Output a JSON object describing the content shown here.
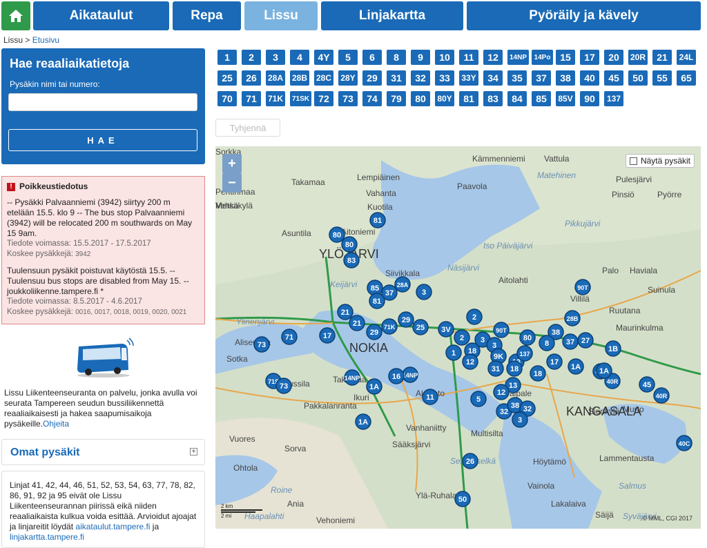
{
  "nav": {
    "home_icon": "home-icon",
    "items": [
      "Aikataulut",
      "Repa",
      "Lissu",
      "Linjakartta",
      "Pyöräily ja kävely"
    ]
  },
  "breadcrumb": {
    "root": "Lissu",
    "separator": " > ",
    "current": "Etusivu"
  },
  "search": {
    "title": "Hae reaaliaikatietoja",
    "label": "Pysäkin nimi tai numero:",
    "value": "",
    "button": "HAE"
  },
  "alert": {
    "title": "Poikkeustiedotus",
    "notices": [
      {
        "text": "-- Pysäkki Palvaanniemi (3942) siirtyy 200 m etelään 15.5. klo 9 -- The bus stop Palvaanniemi (3942) will be relocated 200 m southwards on May 15 9am.",
        "valid": "Tiedote voimassa: 15.5.2017 - 17.5.2017",
        "stops_label": "Koskee pysäkkejä:",
        "stops": "3942"
      },
      {
        "text": "Tuulensuun pysäkit poistuvat käytöstä 15.5. -- Tuulensuu bus stops are disabled from May 15. -- joukkoliikenne.tampere.fi *",
        "valid": "Tiedote voimassa: 8.5.2017 - 4.6.2017",
        "stops_label": "Koskee pysäkkejä:",
        "stops": "0016, 0017, 0018, 0019, 0020, 0021"
      }
    ]
  },
  "info": {
    "text": "Lissu Liikenteenseuranta on palvelu, jonka avulla voi seurata Tampereen seudun bussiliikennettä reaaliaikaisesti ja hakea saapumisaikoja pysäkeille.",
    "link": "Ohjeita"
  },
  "omat": {
    "title": "Omat pysäkit",
    "toggle": "⊞"
  },
  "lines_note": {
    "text": "Linjat 41, 42, 44, 46, 51, 52, 53, 54, 63, 77, 78, 82, 86, 91, 92 ja 95 eivät ole Lissu Liikenteenseurannan piirissä eikä niiden reaaliaikaista kulkua voida esittää. Arvioidut ajoajat ja linjareitit löydät",
    "link1": "aikataulut.tampere.fi",
    "mid": "ja",
    "link2": "linjakartta.tampere.fi"
  },
  "routes": [
    [
      "1",
      "2",
      "3",
      "4",
      "4Y",
      "5",
      "6",
      "8",
      "9",
      "10",
      "11",
      "12",
      "14NP",
      "14Po",
      "15",
      "17",
      "20",
      "20R",
      "21",
      "24L"
    ],
    [
      "25",
      "26",
      "28A",
      "28B",
      "28C",
      "28Y",
      "29",
      "31",
      "32",
      "33",
      "33Y",
      "34",
      "35",
      "37",
      "38",
      "40",
      "45",
      "50",
      "55",
      "65"
    ],
    [
      "70",
      "71",
      "71K",
      "71SK",
      "72",
      "73",
      "74",
      "79",
      "80",
      "80Y",
      "81",
      "83",
      "84",
      "85",
      "85V",
      "90",
      "137"
    ]
  ],
  "clear_button": "Tyhjennä",
  "map": {
    "zoom_in": "+",
    "zoom_out": "−",
    "show_stops": "Näytä pysäkit",
    "scale_km": "2 km",
    "scale_mi": "2 mi",
    "copyright": "© MML, CGI 2017",
    "labels": [
      {
        "t": "Kämmenniemi",
        "c": "#444"
      },
      {
        "t": "Vattula",
        "c": "#444"
      },
      {
        "t": "Takamaa",
        "c": "#444"
      },
      {
        "t": "Lempiäinen",
        "c": "#444"
      },
      {
        "t": "Vahanta",
        "c": "#444"
      },
      {
        "t": "Paavola",
        "c": "#444"
      },
      {
        "t": "Matehinen",
        "c": "#6a8fb4"
      },
      {
        "t": "Pulesjärvi",
        "c": "#444"
      },
      {
        "t": "Pentinmaa",
        "c": "#444"
      },
      {
        "t": "Pinsiö",
        "c": "#444"
      },
      {
        "t": "Pyörre",
        "c": "#444"
      },
      {
        "t": "Kuotila",
        "c": "#444"
      },
      {
        "t": "Vehka",
        "c": "#444"
      },
      {
        "t": "Metsäkylä",
        "c": "#444"
      },
      {
        "t": "Asuntila",
        "c": "#444"
      },
      {
        "t": "Aitoniemi",
        "c": "#444"
      },
      {
        "t": "Iso Päiväjärvi",
        "c": "#6a8fb4"
      },
      {
        "t": "Pikkujärvi",
        "c": "#6a8fb4"
      },
      {
        "t": "YLÖJÄRVI",
        "c": "#333"
      },
      {
        "t": "Siivikkala",
        "c": "#444"
      },
      {
        "t": "Näsijärvi",
        "c": "#6a8fb4"
      },
      {
        "t": "Aitolahti",
        "c": "#444"
      },
      {
        "t": "Palo",
        "c": "#444"
      },
      {
        "t": "Haviala",
        "c": "#444"
      },
      {
        "t": "Suinula",
        "c": "#444"
      },
      {
        "t": "Keijärvi",
        "c": "#6a8fb4"
      },
      {
        "t": "Ruutana",
        "c": "#444"
      },
      {
        "t": "Ylinenjärvi",
        "c": "#6a8fb4"
      },
      {
        "t": "Aliseutula",
        "c": "#444"
      },
      {
        "t": "NOKIA",
        "c": "#333"
      },
      {
        "t": "Villilä",
        "c": "#444"
      },
      {
        "t": "Maurinkulma",
        "c": "#444"
      },
      {
        "t": "Jussila",
        "c": "#444"
      },
      {
        "t": "Takamaa",
        "c": "#444"
      },
      {
        "t": "Taipale",
        "c": "#444"
      },
      {
        "t": "Sotka",
        "c": "#444"
      },
      {
        "t": "Alavisto",
        "c": "#444"
      },
      {
        "t": "Pakkalanranta",
        "c": "#444"
      },
      {
        "t": "Sionkylä",
        "c": "#444"
      },
      {
        "t": "Murto",
        "c": "#444"
      },
      {
        "t": "KANGASALA",
        "c": "#333"
      },
      {
        "t": "Vanhaniitty",
        "c": "#444"
      },
      {
        "t": "Multisilta",
        "c": "#444"
      },
      {
        "t": "Vuores",
        "c": "#444"
      },
      {
        "t": "Sorva",
        "c": "#444"
      },
      {
        "t": "Sääksjärvi",
        "c": "#444"
      },
      {
        "t": "Lammentausta",
        "c": "#444"
      },
      {
        "t": "Ohtola",
        "c": "#444"
      },
      {
        "t": "Servanselkä",
        "c": "#6a8fb4"
      },
      {
        "t": "Höytämö",
        "c": "#444"
      },
      {
        "t": "Ylä-Ruhala",
        "c": "#444"
      },
      {
        "t": "Vainola",
        "c": "#444"
      },
      {
        "t": "Salmus",
        "c": "#6a8fb4"
      },
      {
        "t": "Roine",
        "c": "#6a8fb4"
      },
      {
        "t": "Lakalaiva",
        "c": "#444"
      },
      {
        "t": "Ania",
        "c": "#444"
      },
      {
        "t": "Syväjärvi",
        "c": "#6a8fb4"
      },
      {
        "t": "Vehoniemi",
        "c": "#444"
      },
      {
        "t": "Säijä",
        "c": "#444"
      },
      {
        "t": "Haapalahti",
        "c": "#6a8fb4"
      },
      {
        "t": "Ikuri",
        "c": "#444"
      },
      {
        "t": "Sorkka",
        "c": "#444"
      }
    ],
    "buses": [
      "81",
      "80",
      "80",
      "83",
      "85",
      "28A",
      "37",
      "3",
      "81",
      "90T",
      "21",
      "21",
      "17",
      "71",
      "73",
      "29",
      "71K",
      "29",
      "25",
      "3V",
      "2",
      "2",
      "3",
      "90T",
      "3",
      "18",
      "12",
      "9K",
      "13",
      "137",
      "80",
      "38",
      "8",
      "37",
      "28B",
      "27",
      "17",
      "1A",
      "1B",
      "455",
      "40R",
      "45",
      "40R",
      "31",
      "18",
      "18",
      "13",
      "12",
      "11",
      "5",
      "32",
      "38",
      "32",
      "3",
      "1A",
      "26",
      "50",
      "14NP",
      "14NP",
      "71S",
      "73",
      "16",
      "1A",
      "1A",
      "40C",
      "1"
    ]
  }
}
